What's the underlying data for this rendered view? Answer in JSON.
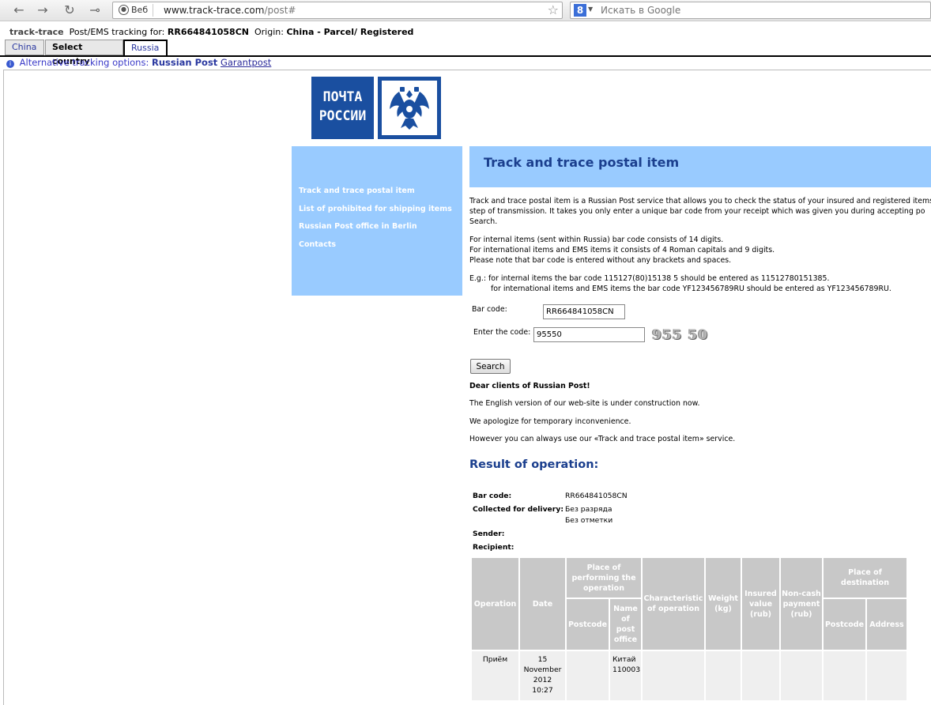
{
  "browser": {
    "chip_label": "Веб",
    "url_host": "www.track-trace.com",
    "url_path": "/post#",
    "search_placeholder": "Искать в Google",
    "search_engine_letter": "8"
  },
  "tracker": {
    "brand": "track-trace",
    "tracking_label": "Post/EMS tracking for:",
    "tracking_number": "RR664841058CN",
    "origin_label": "Origin:",
    "origin_value": "China - Parcel/ Registered",
    "tabs": [
      {
        "label": "China"
      },
      {
        "label": "Select country"
      },
      {
        "label": "Russia"
      }
    ],
    "alt_label": "Alternative tracking options:",
    "alt_primary": "Russian Post",
    "alt_link": "Garantpost"
  },
  "logo": {
    "line1": "ПОЧТА",
    "line2": "РОССИИ"
  },
  "menu": [
    "Track and trace postal item",
    "List of prohibited for shipping items",
    "Russian Post office in Berlin",
    "Contacts"
  ],
  "content": {
    "title": "Track and trace postal item",
    "intro": [
      "Track and trace postal item is a Russian Post service that allows you to check the status of your insured and registered items w",
      "step of transmission. It takes you only  enter a unique bar code from  your receipt which was given you during accepting po",
      "Search."
    ],
    "rules": [
      "For internal items (sent within Russia) bar code consists of 14 digits.",
      "For international items and EMS items it consists of 4 Roman capitals and 9 digits.",
      "Please note that bar code is entered without any brackets and spaces."
    ],
    "example1": "E.g.: for internal items the bar code 115127(80)15138 5 should be entered as 11512780151385.",
    "example2": "for international items and EMS items the bar code YF123456789RU should be entered as YF123456789RU.",
    "barcode_label": "Bar code:",
    "barcode_value": "RR664841058CN",
    "code_label": "Enter the code:",
    "code_value": "95550",
    "captcha_text": "955 50",
    "search_button": "Search",
    "notice_title": "Dear clients of Russian Post!",
    "notice_lines": [
      "The English version of our web-site is under construction now.",
      "We apologize for temporary inconvenience.",
      "However you can always use our «Track and trace postal item» service."
    ]
  },
  "result": {
    "title": "Result of operation:",
    "barcode_label": "Bar code:",
    "barcode_value": "RR664841058CN",
    "collected_label": "Collected for delivery:",
    "collected_value1": "Без разряда",
    "collected_value2": "Без отметки",
    "sender_label": "Sender:",
    "recipient_label": "Recipient:",
    "headers": {
      "operation": "Operation",
      "date": "Date",
      "place_performing": "Place of performing the operation",
      "postcode": "Postcode",
      "name_office": "Name of post office",
      "characteristic": "Characteristic of operation",
      "weight": "Weight (kg)",
      "insured": "Insured value (rub)",
      "noncash": "Non-cash payment (rub)",
      "place_destination": "Place of destination",
      "postcode2": "Postcode",
      "address": "Address"
    },
    "row": {
      "operation": "Приём",
      "date_day": "15",
      "date_month": "November",
      "date_year": "2012",
      "date_time": "10:27",
      "postcode": "",
      "office_name": "Китай",
      "office_code": "110003"
    }
  }
}
